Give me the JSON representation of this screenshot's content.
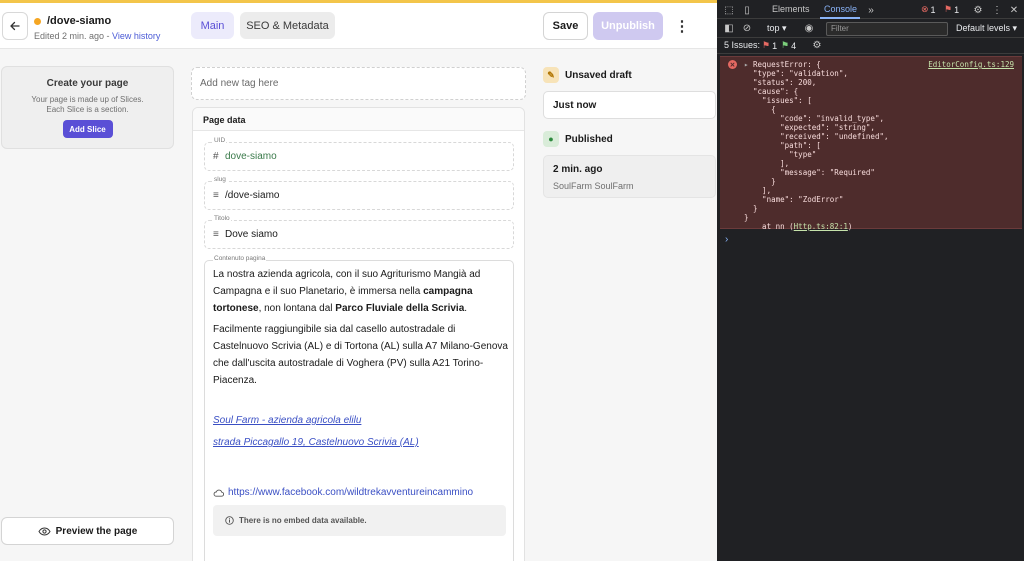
{
  "header": {
    "doc_title": "/dove-siamo",
    "edited": "Edited 2 min. ago",
    "separator": " - ",
    "view_history": "View history",
    "tab_main": "Main",
    "tab_seo": "SEO & Metadata",
    "save": "Save",
    "unpublish": "Unpublish"
  },
  "slices": {
    "title": "Create your page",
    "desc_line1": "Your page is made up of Slices.",
    "desc_line2": "Each Slice is a section.",
    "add_button": "Add Slice",
    "preview": "Preview the page"
  },
  "editor": {
    "tag_placeholder": "Add new tag here",
    "section_title": "Page data",
    "uid_label": "UID",
    "uid_value": "dove-siamo",
    "slug_label": "slug",
    "slug_value": "/dove-siamo",
    "titolo_label": "Titolo",
    "titolo_value": "Dove siamo",
    "content_label": "Contenuto pagina",
    "p1_a": "La nostra azienda agricola, con il suo Agriturismo Mangià ad Campagna e il suo Planetario, è immersa nella ",
    "p1_b": "campagna tortonese",
    "p1_c": ", non lontana dal ",
    "p1_d": "Parco Fluviale della Scrivia",
    "p1_e": ".",
    "p2": "Facilmente raggiungibile sia dal casello autostradale di Castelnuovo Scrivia (AL) e di Tortona (AL) sulla A7 Milano-Genova che dall'uscita autostradale di Voghera (PV) sulla A21 Torino-Piacenza.",
    "link1": "Soul Farm - azienda agricola elilu",
    "link2": "strada Piccagallo 19, Castelnuovo Scrivia (AL)",
    "embed_url": "https://www.facebook.com/wildtrekavventureincammino",
    "embed_note": "There is no embed data available."
  },
  "status": {
    "unsaved_label": "Unsaved draft",
    "unsaved_time": "Just now",
    "published_label": "Published",
    "published_time": "2 min. ago",
    "published_by": "SoulFarm SoulFarm"
  },
  "devtools": {
    "tab_elements": "Elements",
    "tab_console": "Console",
    "error_count": "1",
    "issue_count": "1",
    "context": "top",
    "filter_placeholder": "Filter",
    "levels": "Default levels",
    "issues_label": "5 Issues:",
    "issues_red": "1",
    "issues_green": "4",
    "error_source": "EditorConfig.ts:129",
    "error_text": "RequestError: {\n  \"type\": \"validation\",\n  \"status\": 200,\n  \"cause\": {\n    \"issues\": [\n      {\n        \"code\": \"invalid_type\",\n        \"expected\": \"string\",\n        \"received\": \"undefined\",\n        \"path\": [\n          \"type\"\n        ],\n        \"message\": \"Required\"\n      }\n    ],\n    \"name\": \"ZodError\"\n  }\n}\n    at nn (",
    "error_stack_link": "Http.ts:82:1",
    "error_stack_end": ")"
  },
  "colors": {
    "accent": "#5a4fd6",
    "unsaved": "#f5a623",
    "published": "#3a9a4a"
  }
}
